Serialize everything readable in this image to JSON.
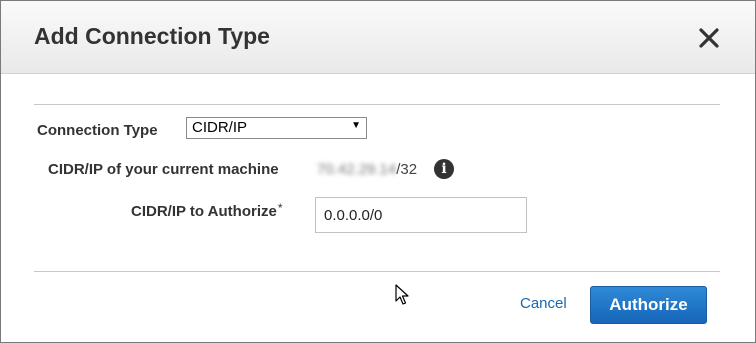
{
  "dialog": {
    "title": "Add Connection Type",
    "close_icon": "close-icon"
  },
  "form": {
    "connection_type_label": "Connection Type",
    "connection_type_value": "CIDR/IP",
    "current_machine_label": "CIDR/IP of your current machine",
    "current_ip_masked": "70.42.29.14",
    "current_ip_suffix": "/32",
    "info_icon": "info-icon",
    "authorize_label": "CIDR/IP to Authorize",
    "required_marker": "*",
    "authorize_value": "0.0.0.0/0"
  },
  "footer": {
    "cancel_label": "Cancel",
    "authorize_button_label": "Authorize"
  },
  "colors": {
    "primary_button": "#1566b8",
    "link": "#1a66b3",
    "title_text": "#333333"
  }
}
